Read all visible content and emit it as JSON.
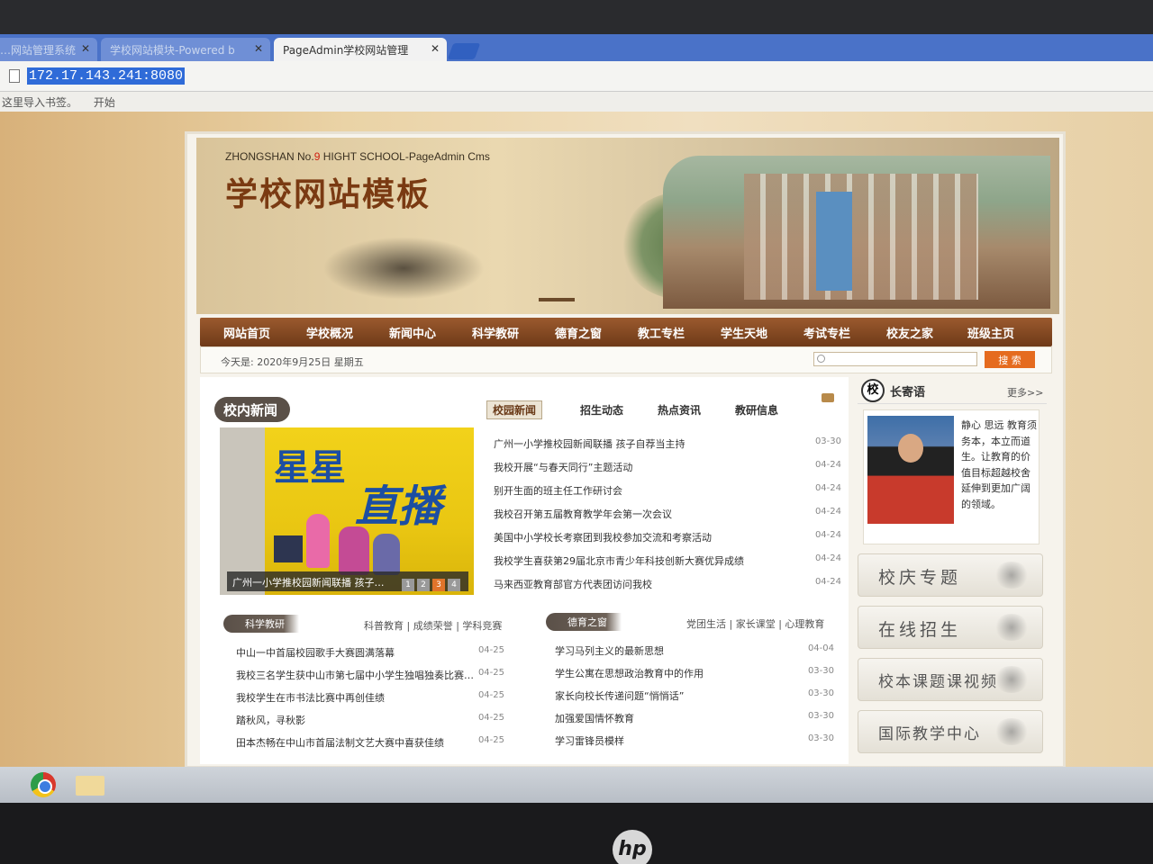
{
  "browser": {
    "tabs": [
      {
        "label": "…网站管理系统"
      },
      {
        "label": "学校网站模块-Powered b"
      },
      {
        "label": "PageAdmin学校网站管理"
      }
    ],
    "url": "172.17.143.241:8080",
    "bookmarks": [
      "这里导入书签。",
      "开始"
    ]
  },
  "banner": {
    "en_prefix": "ZHONGSHAN No.",
    "en_number": "9",
    "en_suffix": " HIGHT SCHOOL-PageAdmin Cms",
    "title": "学校网站模板"
  },
  "nav": [
    "网站首页",
    "学校概况",
    "新闻中心",
    "科学教研",
    "德育之窗",
    "教工专栏",
    "学生天地",
    "考试专栏",
    "校友之家",
    "班级主页"
  ],
  "datebar": {
    "label": "今天是:",
    "date": "2020年9月25日 星期五",
    "search_button": "搜 索"
  },
  "news": {
    "title": "校内新闻",
    "tabs": [
      "校园新闻",
      "招生动态",
      "热点资讯",
      "教研信息"
    ],
    "photo": {
      "caption": "广州一小学推校园新闻联播 孩子…",
      "pages": [
        "1",
        "2",
        "3",
        "4"
      ],
      "text1": "星星",
      "text2": "直播"
    },
    "items": [
      {
        "title": "广州一小学推校园新闻联播 孩子自荐当主持",
        "date": "03-30"
      },
      {
        "title": "我校开展“与春天同行”主题活动",
        "date": "04-24"
      },
      {
        "title": "别开生面的班主任工作研讨会",
        "date": "04-24"
      },
      {
        "title": "我校召开第五届教育教学年会第一次会议",
        "date": "04-24"
      },
      {
        "title": "美国中小学校长考察团到我校参加交流和考察活动",
        "date": "04-24"
      },
      {
        "title": "我校学生喜获第29届北京市青少年科技创新大赛优异成绩",
        "date": "04-24"
      },
      {
        "title": "马来西亚教育部官方代表团访问我校",
        "date": "04-24"
      }
    ]
  },
  "research": {
    "title": "科学教研",
    "links": "科普教育  |  成绩荣誉  |  学科竞赛",
    "items": [
      {
        "title": "中山一中首届校园歌手大赛圆满落幕",
        "date": "04-25"
      },
      {
        "title": "我校三名学生获中山市第七届中小学生独唱独奏比赛…",
        "date": "04-25"
      },
      {
        "title": "我校学生在市书法比赛中再创佳绩",
        "date": "04-25"
      },
      {
        "title": "踏秋风，寻秋影",
        "date": "04-25"
      },
      {
        "title": "田本杰畅在中山市首届法制文艺大赛中喜获佳绩",
        "date": "04-25"
      }
    ]
  },
  "moral": {
    "title": "德育之窗",
    "links": "党团生活  |  家长课堂  |  心理教育",
    "items": [
      {
        "title": "学习马列主义的最新思想",
        "date": "04-04"
      },
      {
        "title": "学生公寓在思想政治教育中的作用",
        "date": "03-30"
      },
      {
        "title": "家长向校长传递问题“悄悄话”",
        "date": "03-30"
      },
      {
        "title": "加强爱国情怀教育",
        "date": "03-30"
      },
      {
        "title": "学习雷锋员模样",
        "date": "03-30"
      }
    ]
  },
  "sidebar": {
    "badge": "校",
    "title": "长寄语",
    "more": "更多>>",
    "motto": "静心 思远 教育须务本，本立而道生。让教育的价值目标超越校舍 延伸到更加广阔的领域。",
    "buttons": [
      "校庆专题",
      "在线招生",
      "校本课题课视频",
      "国际教学中心"
    ]
  },
  "taskbar": {
    "brand": "hp"
  }
}
